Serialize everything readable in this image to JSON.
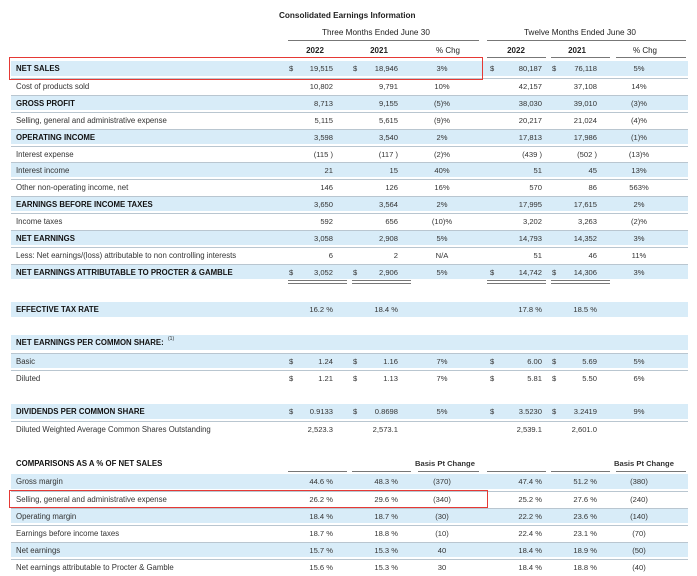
{
  "title": "Consolidated Earnings Information",
  "period_3m": "Three Months Ended June 30",
  "period_12m": "Twelve Months Ended June 30",
  "col_headers": {
    "y2022": "2022",
    "y2021": "2021",
    "chg": "% Chg"
  },
  "basis_pt_change": "Basis Pt Change",
  "dollar": "$",
  "rows": [
    {
      "label": "NET SALES",
      "bold": true,
      "blue": true,
      "dollar": true,
      "v": [
        "19,515",
        "18,946",
        "3%",
        "80,187",
        "76,118",
        "5%"
      ]
    },
    {
      "label": "Cost of products sold",
      "bold": false,
      "blue": false,
      "v": [
        "10,802",
        "9,791",
        "10%",
        "42,157",
        "37,108",
        "14%"
      ]
    },
    {
      "label": "GROSS PROFIT",
      "bold": true,
      "blue": true,
      "v": [
        "8,713",
        "9,155",
        "(5)%",
        "38,030",
        "39,010",
        "(3)%"
      ]
    },
    {
      "label": "Selling, general and administrative expense",
      "bold": false,
      "blue": false,
      "v": [
        "5,115",
        "5,615",
        "(9)%",
        "20,217",
        "21,024",
        "(4)%"
      ]
    },
    {
      "label": "OPERATING INCOME",
      "bold": true,
      "blue": true,
      "v": [
        "3,598",
        "3,540",
        "2%",
        "17,813",
        "17,986",
        "(1)%"
      ]
    },
    {
      "label": "Interest expense",
      "bold": false,
      "blue": false,
      "v": [
        "(115 )",
        "(117 )",
        "(2)%",
        "(439 )",
        "(502 )",
        "(13)%"
      ]
    },
    {
      "label": "Interest income",
      "bold": false,
      "blue": true,
      "v": [
        "21",
        "15",
        "40%",
        "51",
        "45",
        "13%"
      ]
    },
    {
      "label": "Other non-operating income, net",
      "bold": false,
      "blue": false,
      "v": [
        "146",
        "126",
        "16%",
        "570",
        "86",
        "563%"
      ]
    },
    {
      "label": "EARNINGS BEFORE INCOME TAXES",
      "bold": true,
      "blue": true,
      "v": [
        "3,650",
        "3,564",
        "2%",
        "17,995",
        "17,615",
        "2%"
      ]
    },
    {
      "label": "Income taxes",
      "bold": false,
      "blue": false,
      "v": [
        "592",
        "656",
        "(10)%",
        "3,202",
        "3,263",
        "(2)%"
      ]
    },
    {
      "label": "NET EARNINGS",
      "bold": true,
      "blue": true,
      "v": [
        "3,058",
        "2,908",
        "5%",
        "14,793",
        "14,352",
        "3%"
      ]
    },
    {
      "label": "Less: Net earnings/(loss) attributable to non controlling interests",
      "bold": false,
      "blue": false,
      "v": [
        "6",
        "2",
        "N/A",
        "51",
        "46",
        "11%"
      ]
    },
    {
      "label": "NET EARNINGS ATTRIBUTABLE TO PROCTER & GAMBLE",
      "bold": true,
      "blue": true,
      "dollar": true,
      "v": [
        "3,052",
        "2,906",
        "5%",
        "14,742",
        "14,306",
        "3%"
      ]
    }
  ],
  "tax": {
    "label": "EFFECTIVE TAX RATE",
    "v": [
      "16.2 %",
      "18.4 %",
      "",
      "17.8 %",
      "18.5 %",
      ""
    ]
  },
  "eps_header": "NET EARNINGS PER COMMON SHARE:",
  "eps_note": "(1)",
  "eps": [
    {
      "label": "Basic",
      "v": [
        "1.24",
        "1.16",
        "7%",
        "6.00",
        "5.69",
        "5%"
      ]
    },
    {
      "label": "Diluted",
      "v": [
        "1.21",
        "1.13",
        "7%",
        "5.81",
        "5.50",
        "6%"
      ]
    }
  ],
  "dividends": {
    "label": "DIVIDENDS PER COMMON SHARE",
    "v": [
      "0.9133",
      "0.8698",
      "5%",
      "3.5230",
      "3.2419",
      "9%"
    ]
  },
  "shares": {
    "label": "Diluted Weighted Average Common Shares Outstanding",
    "v": [
      "2,523.3",
      "2,573.1",
      "",
      "2,539.1",
      "2,601.0",
      ""
    ]
  },
  "comp_header": "COMPARISONS AS A % OF NET SALES",
  "comp": [
    {
      "label": "Gross margin",
      "v": [
        "44.6 %",
        "48.3 %",
        "(370)",
        "47.4 %",
        "51.2 %",
        "(380)"
      ]
    },
    {
      "label": "Selling, general and administrative expense",
      "v": [
        "26.2 %",
        "29.6 %",
        "(340)",
        "25.2 %",
        "27.6 %",
        "(240)"
      ]
    },
    {
      "label": "Operating margin",
      "v": [
        "18.4 %",
        "18.7 %",
        "(30)",
        "22.2 %",
        "23.6 %",
        "(140)"
      ]
    },
    {
      "label": "Earnings before income taxes",
      "v": [
        "18.7 %",
        "18.8 %",
        "(10)",
        "22.4 %",
        "23.1 %",
        "(70)"
      ]
    },
    {
      "label": "Net earnings",
      "v": [
        "15.7 %",
        "15.3 %",
        "40",
        "18.4 %",
        "18.9 %",
        "(50)"
      ]
    },
    {
      "label": "Net earnings attributable to Procter & Gamble",
      "v": [
        "15.6 %",
        "15.3 %",
        "30",
        "18.4 %",
        "18.8 %",
        "(40)"
      ]
    }
  ]
}
